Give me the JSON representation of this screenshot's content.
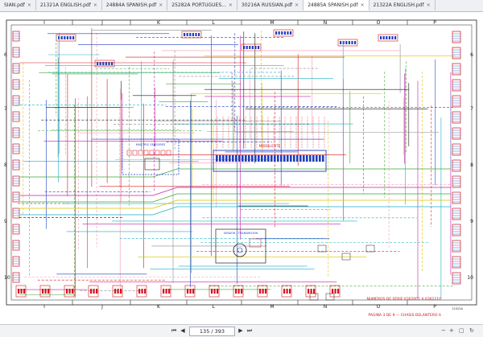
{
  "tabs": [
    {
      "label": "SIAN.pdf",
      "active": false
    },
    {
      "label": "21321A ENGLISH.pdf",
      "active": false
    },
    {
      "label": "24884A SPANISH.pdf",
      "active": false
    },
    {
      "label": "25282A PORTUGUES...",
      "active": false
    },
    {
      "label": "30216A RUSSIAN.pdf",
      "active": false
    },
    {
      "label": "24885A SPANISH.pdf",
      "active": true
    },
    {
      "label": "21322A ENGLISH.pdf",
      "active": false
    }
  ],
  "schematic": {
    "col_labels": [
      "I",
      "J",
      "K",
      "L",
      "M",
      "N",
      "O",
      "P"
    ],
    "row_labels": [
      "6",
      "7",
      "8",
      "9",
      "10"
    ],
    "box_title_left": "MULTIPLE SENSORES",
    "box_title_sensor": "SENSOR / TRANSMISION",
    "module_label": "MODULO ETE",
    "serial_note": "NUMEROS DE SERIE 6302001 A 6302210",
    "page_note": "PAGINA 3 DE 9 — CHASIS DELANTERO A",
    "doc_code": "21322A",
    "colors": {
      "red": "#d4141c",
      "blue": "#1f3fbf",
      "green": "#3fa63a",
      "yellow": "#d8c400",
      "black": "#1a1a1a",
      "magenta": "#c81ea8",
      "cyan": "#18b0c8",
      "gray": "#8a8a8a",
      "pink": "#f09ab0"
    }
  },
  "toolbar": {
    "first_icon": "first-page-icon",
    "prev_icon": "previous-page-icon",
    "page_display": "135 / 393",
    "next_icon": "next-page-icon",
    "last_icon": "last-page-icon",
    "zoom_out_icon": "zoom-out-icon",
    "zoom_in_icon": "zoom-in-icon",
    "fit_icon": "fit-page-icon",
    "rotate_icon": "rotate-icon"
  }
}
